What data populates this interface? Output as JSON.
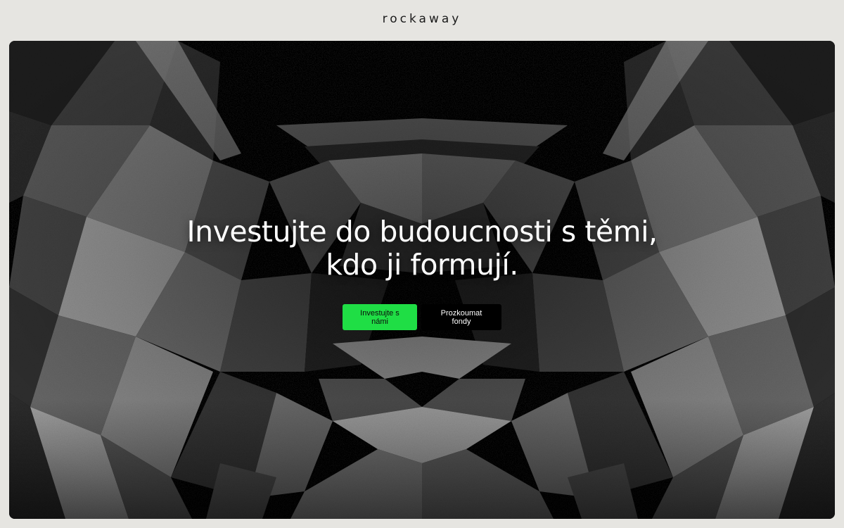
{
  "header": {
    "logo_text": "rockaway"
  },
  "hero": {
    "headline_line1": "Investujte do budoucnosti s těmi,",
    "headline_line2": "kdo ji formují.",
    "primary_cta_label": "Investujte s námi",
    "secondary_cta_label": "Prozkoumat fondy"
  },
  "colors": {
    "page_background": "#e6e5e1",
    "hero_background": "#070707",
    "primary_cta": "#1fde45",
    "secondary_cta": "#000000",
    "headline_text": "#ffffff"
  }
}
